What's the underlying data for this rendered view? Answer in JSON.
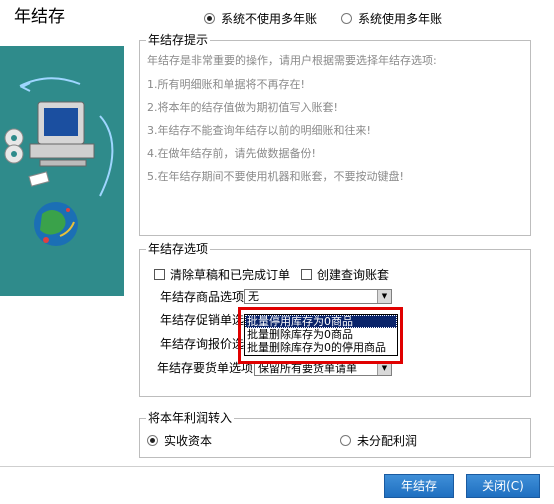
{
  "window": {
    "title": "年结存"
  },
  "mode_radios": [
    {
      "label": "系统不使用多年账",
      "selected": true
    },
    {
      "label": "系统使用多年账",
      "selected": false
    }
  ],
  "tips": {
    "title": "年结存提示",
    "intro": "年结存是非常重要的操作，请用户根据需要选择年结存选项:",
    "items": [
      "1.所有明细账和单据将不再存在!",
      "2.将本年的结存值做为期初值写入账套!",
      "3.年结存不能查询年结存以前的明细账和往来!",
      "4.在做年结存前，请先做数据备份!",
      "5.在年结存期间不要使用机器和账套，不要按动键盘!"
    ]
  },
  "options": {
    "title": "年结存选项",
    "checkboxes": [
      {
        "label": "清除草稿和已完成订单",
        "checked": false
      },
      {
        "label": "创建查询账套",
        "checked": false
      }
    ],
    "rows": [
      {
        "label": "年结存商品选项",
        "value": "无"
      },
      {
        "label": "年结存促销单选",
        "value": ""
      },
      {
        "label": "年结存询报价选",
        "value": ""
      },
      {
        "label": "年结存要货单选项",
        "value": "保留所有要货单请单"
      }
    ],
    "dropdown_options": [
      {
        "label": "批量停用库存为0商品",
        "selected": true
      },
      {
        "label": "批量删除库存为0商品",
        "selected": false
      },
      {
        "label": "批量删除库存为0的停用商品",
        "selected": false
      }
    ]
  },
  "profit": {
    "title": "将本年利润转入",
    "radios": [
      {
        "label": "实收资本",
        "selected": true
      },
      {
        "label": "未分配利润",
        "selected": false
      }
    ]
  },
  "buttons": {
    "year_end": "年结存",
    "close": "关闭(C)"
  },
  "colors": {
    "highlight": "#e00000",
    "button": "#1f6fc0",
    "panel": "#2f8b8b"
  }
}
